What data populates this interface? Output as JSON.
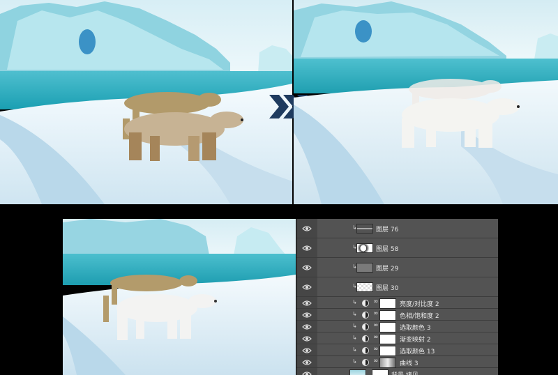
{
  "layers_panel": {
    "rows": [
      {
        "name": "图层 76",
        "kind": "line-thumb"
      },
      {
        "name": "图层 58",
        "kind": "bear-thumb"
      },
      {
        "name": "图层 29",
        "kind": "gray-thumb"
      },
      {
        "name": "图层 30",
        "kind": "checker-thumb"
      },
      {
        "name": "亮度/对比度 2",
        "kind": "adjustment"
      },
      {
        "name": "色相/饱和度 2",
        "kind": "adjustment"
      },
      {
        "name": "选取颜色 3",
        "kind": "adjustment"
      },
      {
        "name": "渐变映射 2",
        "kind": "adjustment"
      },
      {
        "name": "选取颜色 13",
        "kind": "adjustment"
      },
      {
        "name": "曲线 3",
        "kind": "curve"
      },
      {
        "name": "背景 拷贝",
        "kind": "background"
      }
    ]
  },
  "colors": {
    "panel_bg": "#535353",
    "arrow": "#1e3b5f",
    "sky": "#cfe9f3",
    "sea": "#2fb0bf",
    "snow": "#e8f4fa"
  },
  "icons": [
    "eye-icon",
    "chain-link-icon",
    "clip-icon",
    "adjustment-icon",
    "chevron-right-icon"
  ]
}
